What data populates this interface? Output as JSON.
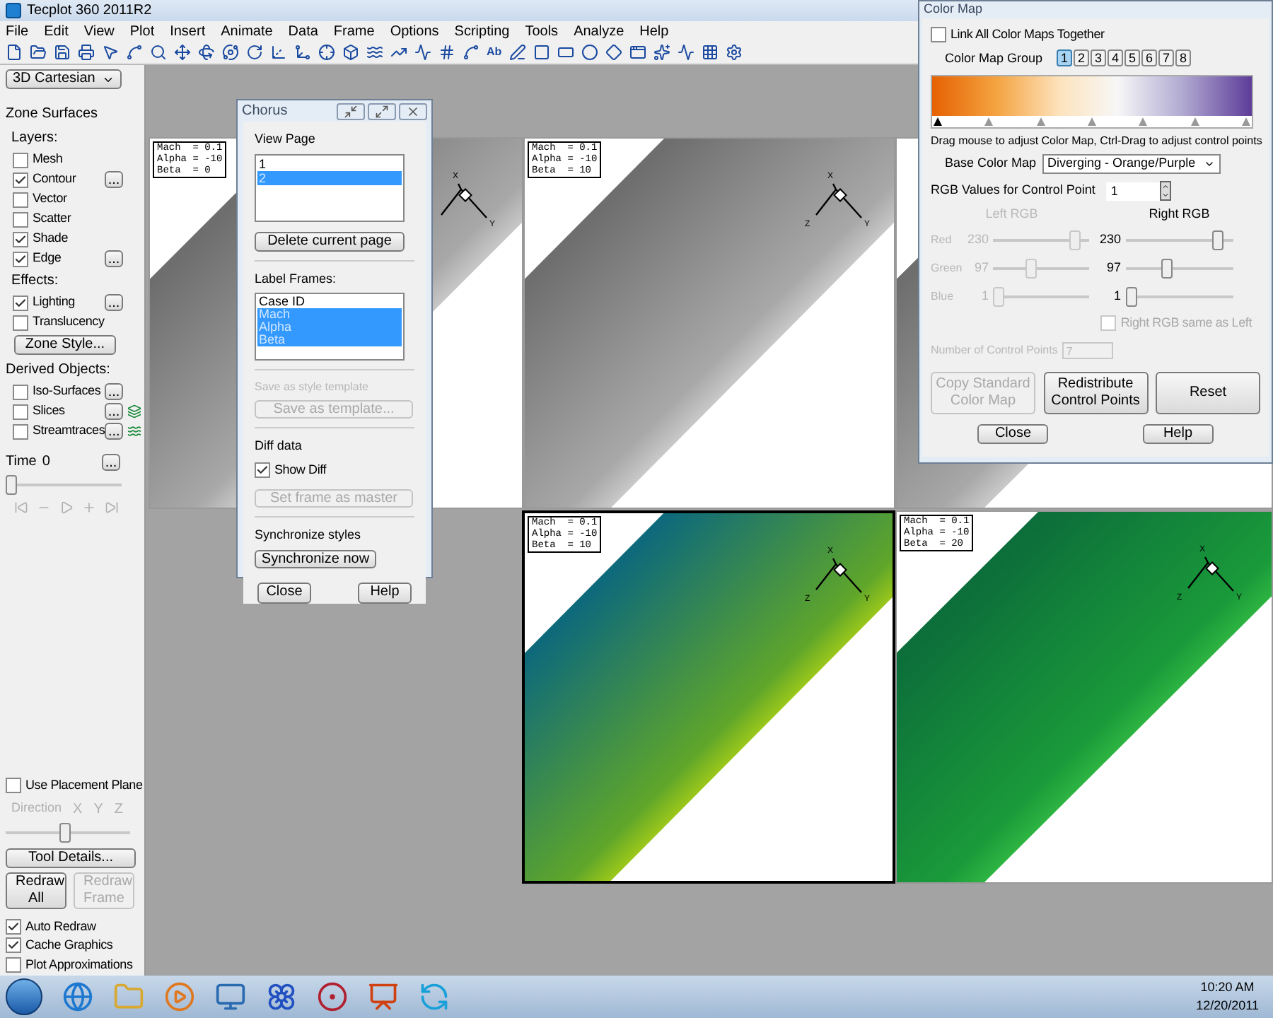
{
  "window": {
    "title": "Tecplot 360 2011R2"
  },
  "menu": [
    "File",
    "Edit",
    "View",
    "Plot",
    "Insert",
    "Animate",
    "Data",
    "Frame",
    "Options",
    "Scripting",
    "Tools",
    "Analyze",
    "Help"
  ],
  "toolbar": {
    "text_tool": "Ab"
  },
  "sidebar": {
    "plot_type": "3D Cartesian",
    "rows": [
      {
        "kind": "heading",
        "text": "Zone Surfaces"
      },
      {
        "kind": "subheading",
        "text": "Layers:"
      },
      {
        "kind": "check",
        "label": "Mesh",
        "checked": false
      },
      {
        "kind": "check",
        "label": "Contour",
        "checked": true,
        "more": "..."
      },
      {
        "kind": "check",
        "label": "Vector",
        "checked": false
      },
      {
        "kind": "check",
        "label": "Scatter",
        "checked": false
      },
      {
        "kind": "check",
        "label": "Shade",
        "checked": true
      },
      {
        "kind": "check",
        "label": "Edge",
        "checked": true,
        "more": "..."
      },
      {
        "kind": "subheading",
        "text": "Effects:"
      },
      {
        "kind": "check",
        "label": "Lighting",
        "checked": true,
        "more": "..."
      },
      {
        "kind": "check",
        "label": "Translucency",
        "checked": false
      },
      {
        "kind": "button",
        "label": "Zone Style..."
      },
      {
        "kind": "heading",
        "text": "Derived Objects:"
      },
      {
        "kind": "check",
        "label": "Iso-Surfaces",
        "checked": false,
        "more": "..."
      },
      {
        "kind": "tool",
        "label": "Slices",
        "checked": false,
        "more": "..."
      },
      {
        "kind": "tool",
        "label": "Streamtraces",
        "checked": false,
        "more": "..."
      }
    ],
    "time": {
      "label": "Time",
      "value": "0",
      "more": "...",
      "level": 0
    },
    "placement": {
      "label": "Use Placement Plane",
      "checked": false
    },
    "direction": {
      "label": "Direction",
      "axes": [
        "X",
        "Y",
        "Z"
      ],
      "disabled": true,
      "level": 0.48
    },
    "tool_details": "Tool Details...",
    "redraw": [
      {
        "label": "Redraw All",
        "disabled": false
      },
      {
        "label": "Redraw Frame",
        "disabled": true
      }
    ],
    "options": [
      {
        "label": "Auto Redraw",
        "checked": true
      },
      {
        "label": "Cache Graphics",
        "checked": true
      },
      {
        "label": "Plot Approximations",
        "checked": false
      }
    ]
  },
  "frames": [
    {
      "kind": "gray",
      "label": [
        "Mach  = 0.1",
        "Alpha = -10",
        "Beta  = 0"
      ],
      "axes": [
        "X",
        "Y"
      ]
    },
    {
      "kind": "gray",
      "label": [
        "Mach  = 0.1",
        "Alpha = -10",
        "Beta  = 10"
      ],
      "axes": [
        "X",
        "Y",
        "Z"
      ]
    },
    {
      "kind": "gray"
    },
    {
      "kind": "contour",
      "label": [
        "Mach  = 0.1",
        "Alpha = -10",
        "Beta  = 10"
      ],
      "axes": [
        "X",
        "Y",
        "Z"
      ]
    },
    {
      "kind": "green",
      "label": [
        "Mach  = 0.1",
        "Alpha = -10",
        "Beta  = 20"
      ],
      "axes": [
        "X",
        "Y",
        "Z"
      ]
    }
  ],
  "chorus": {
    "title": "Chorus",
    "view_page": {
      "label": "View Page",
      "items": [
        {
          "text": "1",
          "selected": false
        },
        {
          "text": "2",
          "selected": true
        }
      ]
    },
    "delete_button": "Delete current page",
    "label_frames": {
      "label": "Label Frames:",
      "items": [
        {
          "text": "Case ID",
          "selected": false
        },
        {
          "text": "Mach",
          "selected": true
        },
        {
          "text": "Alpha",
          "selected": true
        },
        {
          "text": "Beta",
          "selected": true
        }
      ]
    },
    "template": {
      "label": "Save as style template",
      "button": "Save as template...",
      "disabled": true
    },
    "diff": {
      "label": "Diff data",
      "checkbox": {
        "label": "Show Diff",
        "checked": true
      },
      "button": "Set frame as master",
      "disabled": true
    },
    "sync": {
      "label": "Synchronize styles",
      "button": "Synchronize now"
    },
    "buttons": [
      "Close",
      "Help"
    ]
  },
  "color_map": {
    "title": "Color Map",
    "link": {
      "label": "Link All Color Maps Together",
      "checked": false
    },
    "group": {
      "label": "Color Map Group",
      "items": [
        {
          "text": "1",
          "selected": true
        },
        {
          "text": "2",
          "selected": false
        },
        {
          "text": "3",
          "selected": false
        },
        {
          "text": "4",
          "selected": false
        },
        {
          "text": "5",
          "selected": false
        },
        {
          "text": "6",
          "selected": false
        },
        {
          "text": "7",
          "selected": false
        },
        {
          "text": "8",
          "selected": false
        }
      ]
    },
    "hint": "Drag mouse to adjust Color Map, Ctrl-Drag to adjust control points",
    "base": {
      "label": "Base Color Map",
      "value": "Diverging - Orange/Purple"
    },
    "control_point": {
      "label": "RGB Values for Control Point",
      "value": "1"
    },
    "left": {
      "heading": "Left RGB",
      "disabled": true,
      "channels": [
        {
          "name": "Red",
          "value": "230",
          "level": 0.9
        },
        {
          "name": "Green",
          "value": "97",
          "level": 0.38
        },
        {
          "name": "Blue",
          "value": "1",
          "level": 0
        }
      ]
    },
    "right": {
      "heading": "Right RGB",
      "disabled": false,
      "channels": [
        {
          "value": "230",
          "level": 0.9
        },
        {
          "value": "97",
          "level": 0.38
        },
        {
          "value": "1",
          "level": 0
        }
      ]
    },
    "same_as_left": {
      "label": "Right RGB same as Left",
      "checked": false,
      "disabled": true
    },
    "num_points": {
      "label": "Number of Control Points",
      "value": "7",
      "disabled": true
    },
    "actions": [
      {
        "label": "Copy Standard Color Map",
        "disabled": true
      },
      {
        "label": "Redistribute Control Points",
        "disabled": false
      },
      {
        "label": "Reset",
        "disabled": false
      }
    ],
    "buttons": [
      "Close",
      "Help"
    ]
  },
  "taskbar": {
    "time": "10:20 AM",
    "date": "12/20/2011"
  }
}
